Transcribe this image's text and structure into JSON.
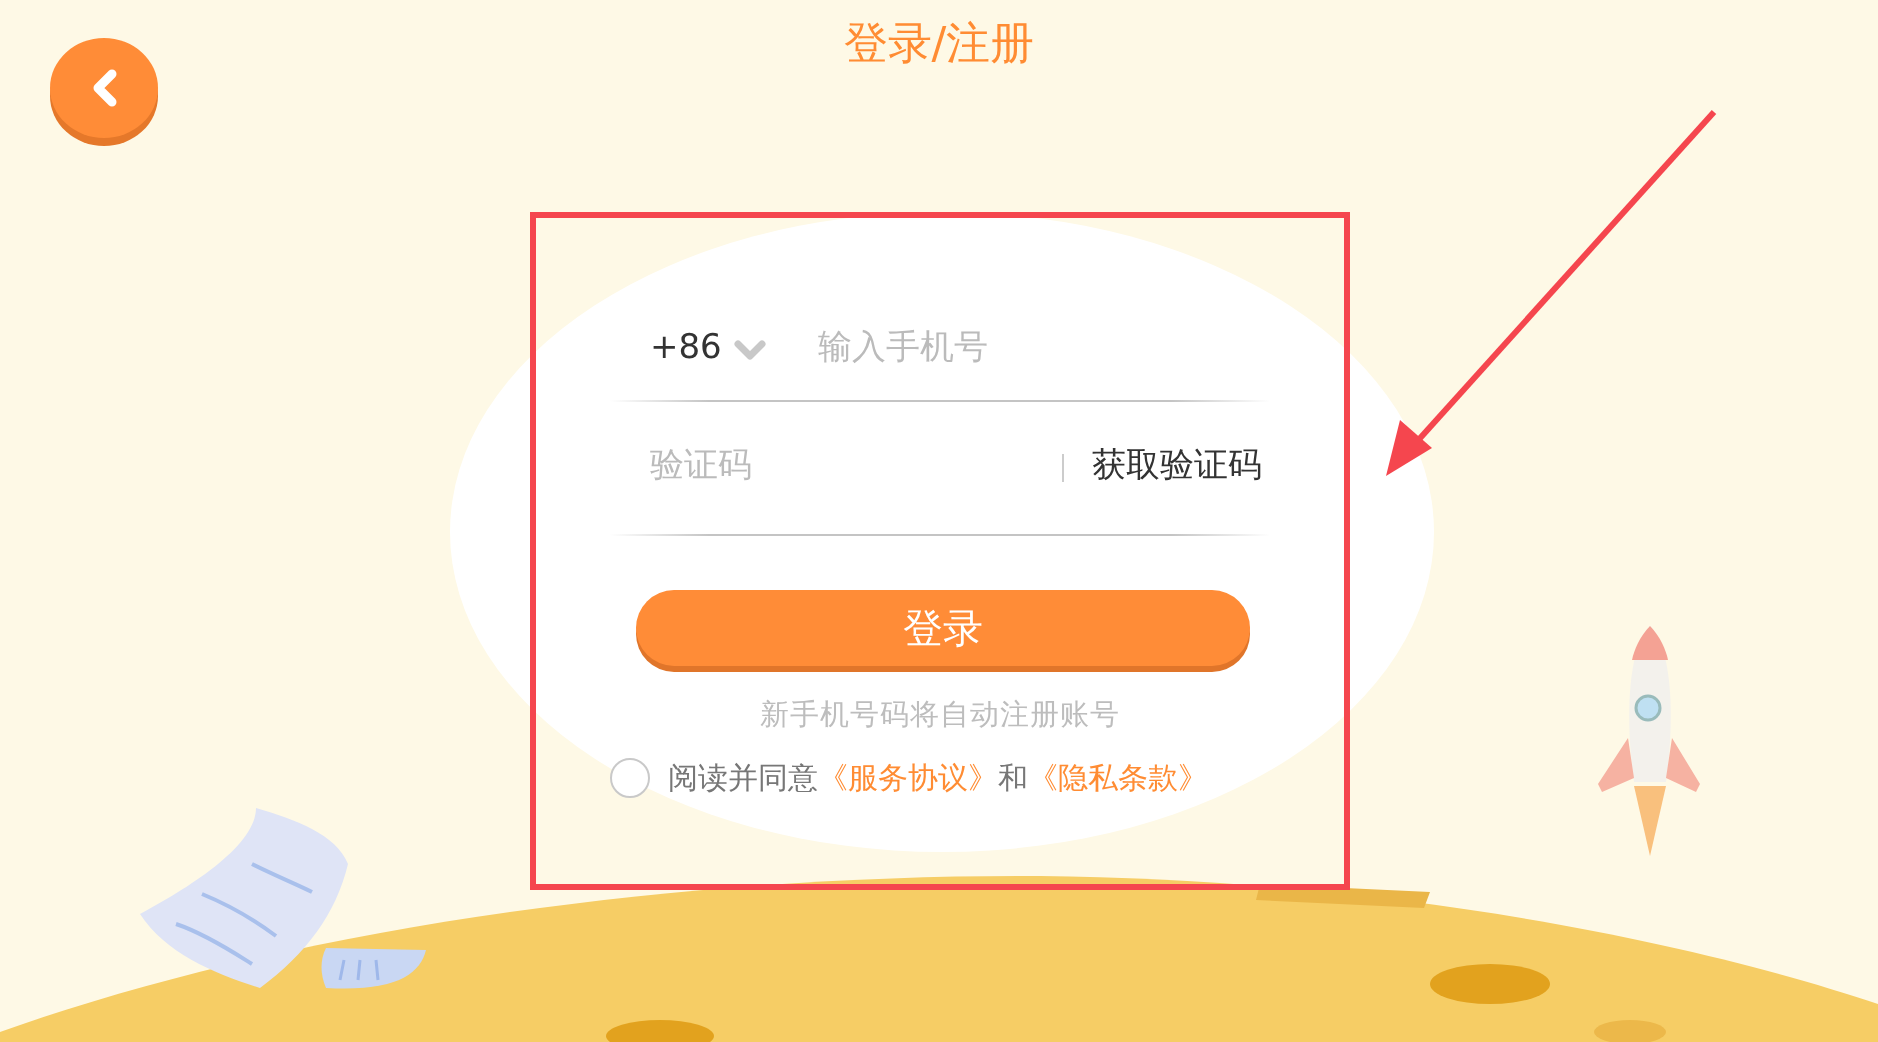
{
  "header": {
    "title": "登录/注册"
  },
  "form": {
    "country_code": "+86",
    "phone": {
      "placeholder": "输入手机号"
    },
    "code": {
      "placeholder": "验证码"
    },
    "get_code_button": "获取验证码",
    "login_button": "登录",
    "hint": "新手机号码将自动注册账号",
    "agreement": {
      "checked": false,
      "text": "阅读并同意",
      "conjunction": "和",
      "links": [
        "《服务协议》",
        "《隐私条款》"
      ]
    }
  }
}
